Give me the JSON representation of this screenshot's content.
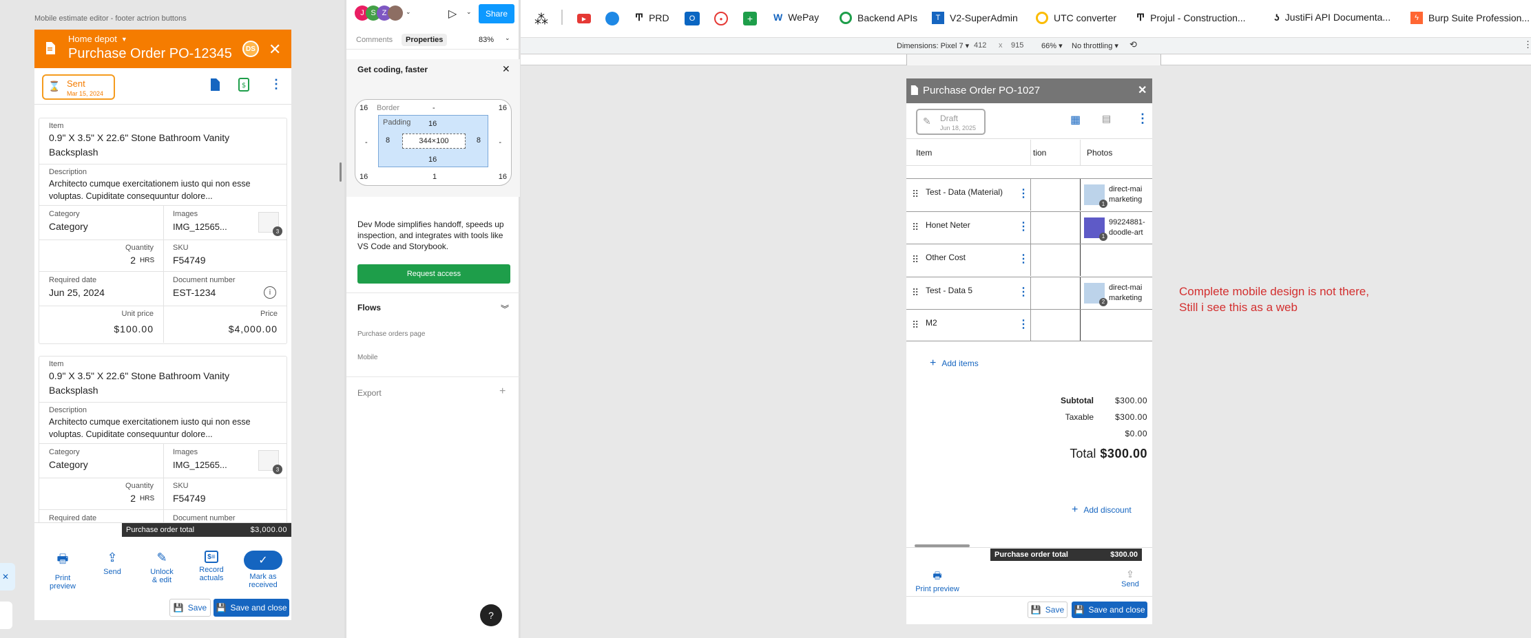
{
  "left": {
    "frame_label": "Mobile estimate editor - footer actrion buttons",
    "vendor": "Home depot",
    "title": "Purchase Order PO-12345",
    "avatar": "DS",
    "status": "Sent",
    "status_date": "Mar 15, 2024",
    "cards": [
      {
        "item_label": "Item",
        "item": "0.9\" X 3.5\" X 22.6\" Stone Bathroom Vanity Backsplash",
        "desc_label": "Description",
        "desc": "Architecto cumque exercitationem iusto qui non esse voluptas. Cupiditate consequuntur dolore...",
        "cat_label": "Category",
        "cat": "Category",
        "img_label": "Images",
        "img": "IMG_12565...",
        "img_count": "3",
        "qty_label": "Quantity",
        "qty": "2",
        "unit": "HRS",
        "sku_label": "SKU",
        "sku": "F54749",
        "req_label": "Required date",
        "req": "Jun 25, 2024",
        "doc_label": "Document number",
        "doc": "EST-1234",
        "up_label": "Unit price",
        "up": "$100.00",
        "price_label": "Price",
        "price": "$4,000.00"
      },
      {
        "item_label": "Item",
        "item": "0.9\" X 3.5\" X 22.6\" Stone Bathroom Vanity Backsplash",
        "desc_label": "Description",
        "desc": "Architecto cumque exercitationem iusto qui non esse voluptas. Cupiditate consequuntur dolore...",
        "cat_label": "Category",
        "cat": "Category",
        "img_label": "Images",
        "img": "IMG_12565...",
        "img_count": "3",
        "qty_label": "Quantity",
        "qty": "2",
        "unit": "HRS",
        "sku_label": "SKU",
        "sku": "F54749",
        "req_label": "Required date",
        "doc_label": "Document number"
      }
    ],
    "total_label": "Purchase order total",
    "total": "$3,000.00",
    "actions": [
      {
        "label": "Print\npreview"
      },
      {
        "label": "Send"
      },
      {
        "label": "Unlock\n& edit"
      },
      {
        "label": "Record\nactuals"
      },
      {
        "label": "Mark as\nreceived"
      }
    ],
    "save": "Save",
    "save_close": "Save and close"
  },
  "panel": {
    "avatars": [
      "J",
      "S",
      "Z"
    ],
    "share": "Share",
    "tabs": [
      "Comments",
      "Properties"
    ],
    "zoom": "83%",
    "banner": "Get coding, faster",
    "box": {
      "border_label": "Border",
      "padding_label": "Padding",
      "size": "344×100",
      "top": "16",
      "right": "16",
      "bottom": "16",
      "left": "16",
      "border_val": "-",
      "border_left": "-",
      "border_right": "-",
      "border_bottom": "1",
      "pad_top": "16",
      "pad_bottom": "16",
      "pad_left": "8",
      "pad_right": "8",
      "corner_bl": "16",
      "corner_br": "16"
    },
    "dev_text": "Dev Mode simplifies handoff, speeds up inspection, and integrates with tools like VS Code and Storybook.",
    "request": "Request access",
    "flows": "Flows",
    "flow_items": [
      "Purchase orders page",
      "Mobile"
    ],
    "export": "Export",
    "help": "?"
  },
  "browser": {
    "bookmarks": [
      "PRD",
      "WePay",
      "Backend APIs",
      "V2-SuperAdmin",
      "UTC converter",
      "Projul - Construction...",
      "JustiFi API Documenta...",
      "Burp Suite Profession..."
    ],
    "device": "Dimensions: Pixel 7",
    "width": "412",
    "x": "x",
    "height": "915",
    "zoom": "66%",
    "throttle": "No throttling"
  },
  "right": {
    "title": "Purchase Order PO-1027",
    "status": "Draft",
    "status_date": "Jun 18, 2025",
    "headers": [
      "Item",
      "tion",
      "Photos"
    ],
    "rows": [
      {
        "name": "Test - Data (Material)",
        "photo": "direct-mai marketing",
        "count": "1"
      },
      {
        "name": "Honet Neter",
        "photo": "99224881- doodle-art",
        "count": "1"
      },
      {
        "name": "Other Cost",
        "photo": "",
        "count": ""
      },
      {
        "name": "Test - Data 5",
        "photo": "direct-mai marketing",
        "count": "2"
      },
      {
        "name": "M2",
        "photo": "",
        "count": ""
      }
    ],
    "add_items": "Add items",
    "subtotal_label": "Subtotal",
    "subtotal": "$300.00",
    "taxable_label": "Taxable",
    "taxable": "$300.00",
    "zero": "$0.00",
    "total_label": "Total",
    "total": "$300.00",
    "add_discount": "Add discount",
    "po_total_label": "Purchase order total",
    "po_total": "$300.00",
    "print": "Print preview",
    "send": "Send",
    "save": "Save",
    "save_close": "Save and close"
  },
  "comment": "Complete mobile design is not there,\nStill i see this as a web",
  "colors": {
    "orange": "#f57c00",
    "blue": "#1565c0",
    "green": "#1e9e4a",
    "red": "#d32f2f",
    "grey_header": "#757575"
  }
}
